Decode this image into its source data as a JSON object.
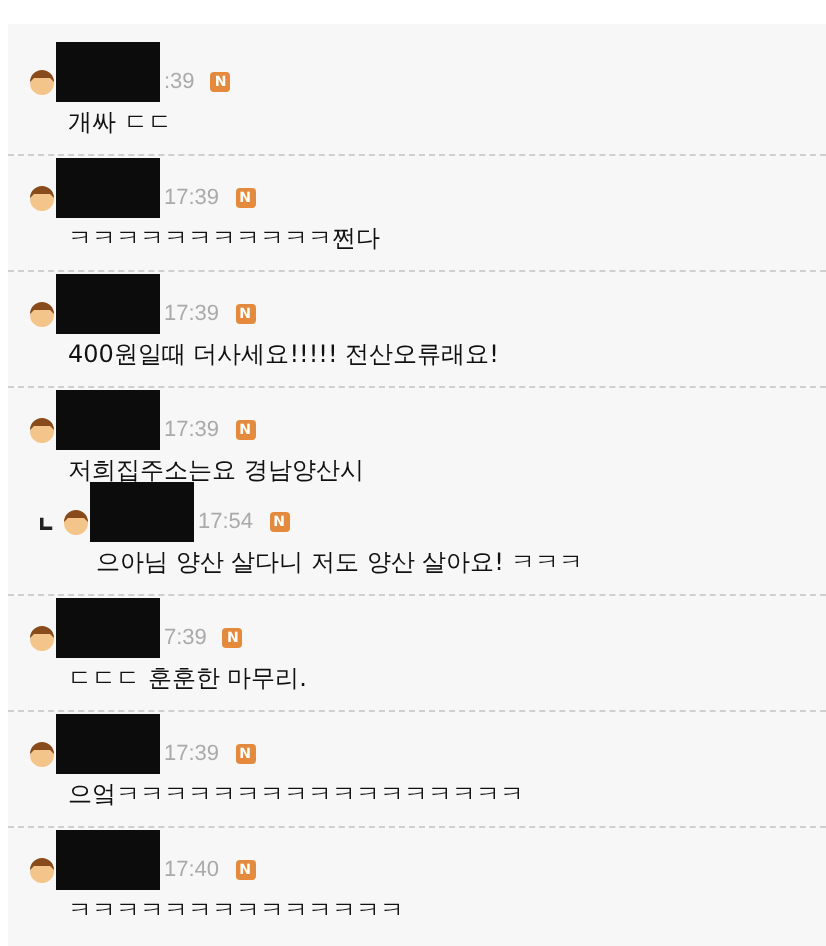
{
  "comments": [
    {
      "kind": "comment",
      "time": ":39",
      "badge": "N",
      "text": "개싸 ㄷㄷ"
    },
    {
      "kind": "comment",
      "time": "17:39",
      "badge": "N",
      "text": "ㅋㅋㅋㅋㅋㅋㅋㅋㅋㅋㅋ쩐다"
    },
    {
      "kind": "comment",
      "time": "17:39",
      "badge": "N",
      "text": "400원일때 더사세요!!!!! 전산오류래요!"
    },
    {
      "kind": "comment",
      "time": "17:39",
      "badge": "N",
      "text": "저희집주소는요 경남양산시"
    },
    {
      "kind": "reply",
      "time": "17:54",
      "badge": "N",
      "text": "으아님 양산 살다니 저도 양산 살아요! ㅋㅋㅋ"
    },
    {
      "kind": "comment",
      "time": "7:39",
      "badge": "N",
      "text": "ㄷㄷㄷ 훈훈한 마무리."
    },
    {
      "kind": "comment",
      "time": "17:39",
      "badge": "N",
      "text": "으엌ㅋㅋㅋㅋㅋㅋㅋㅋㅋㅋㅋㅋㅋㅋㅋㅋㅋ"
    },
    {
      "kind": "comment",
      "time": "17:40",
      "badge": "N",
      "text": "ㅋㅋㅋㅋㅋㅋㅋㅋㅋㅋㅋㅋㅋㅋ"
    }
  ]
}
